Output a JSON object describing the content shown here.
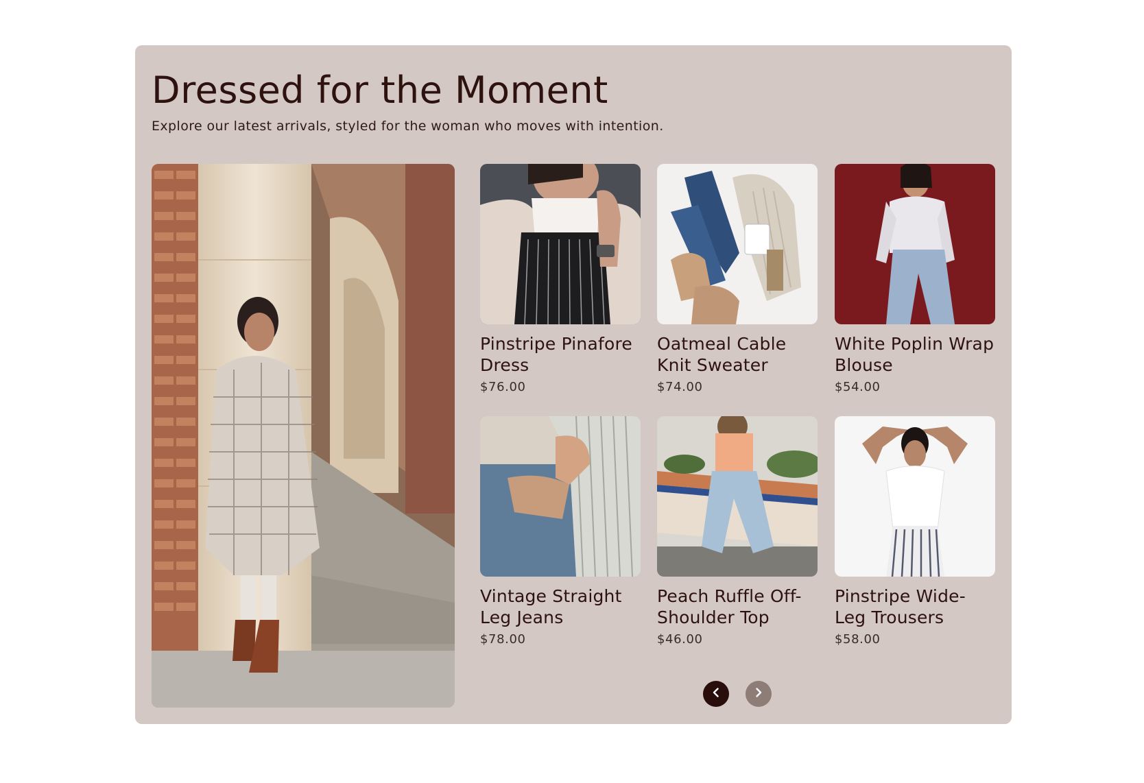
{
  "section": {
    "title": "Dressed for the Moment",
    "subtitle": "Explore our latest arrivals, styled for the woman who moves with intention."
  },
  "hero": {
    "image": "woman-in-plaid-coat-photo"
  },
  "products": [
    {
      "name": "Pinstripe Pinafore Dress",
      "price": "$76.00",
      "image": "pinstripe-pinafore-photo"
    },
    {
      "name": "Oatmeal Cable Knit Sweater",
      "price": "$74.00",
      "image": "sweater-flatlay-photo"
    },
    {
      "name": "White Poplin Wrap Blouse",
      "price": "$54.00",
      "image": "white-blouse-photo"
    },
    {
      "name": "Vintage Straight Leg Jeans",
      "price": "$78.00",
      "image": "jeans-pocket-photo"
    },
    {
      "name": "Peach Ruffle Off-Shoulder Top",
      "price": "$46.00",
      "image": "peach-top-photo"
    },
    {
      "name": "Pinstripe Wide-Leg Trousers",
      "price": "$58.00",
      "image": "striped-trousers-photo"
    }
  ],
  "carousel": {
    "prev_icon": "chevron-left-icon",
    "next_icon": "chevron-right-icon"
  },
  "colors": {
    "background": "#d3c8c3",
    "heading": "#2e1210",
    "nav_active": "#2a0e0c",
    "nav_inactive": "#8e7c77"
  }
}
